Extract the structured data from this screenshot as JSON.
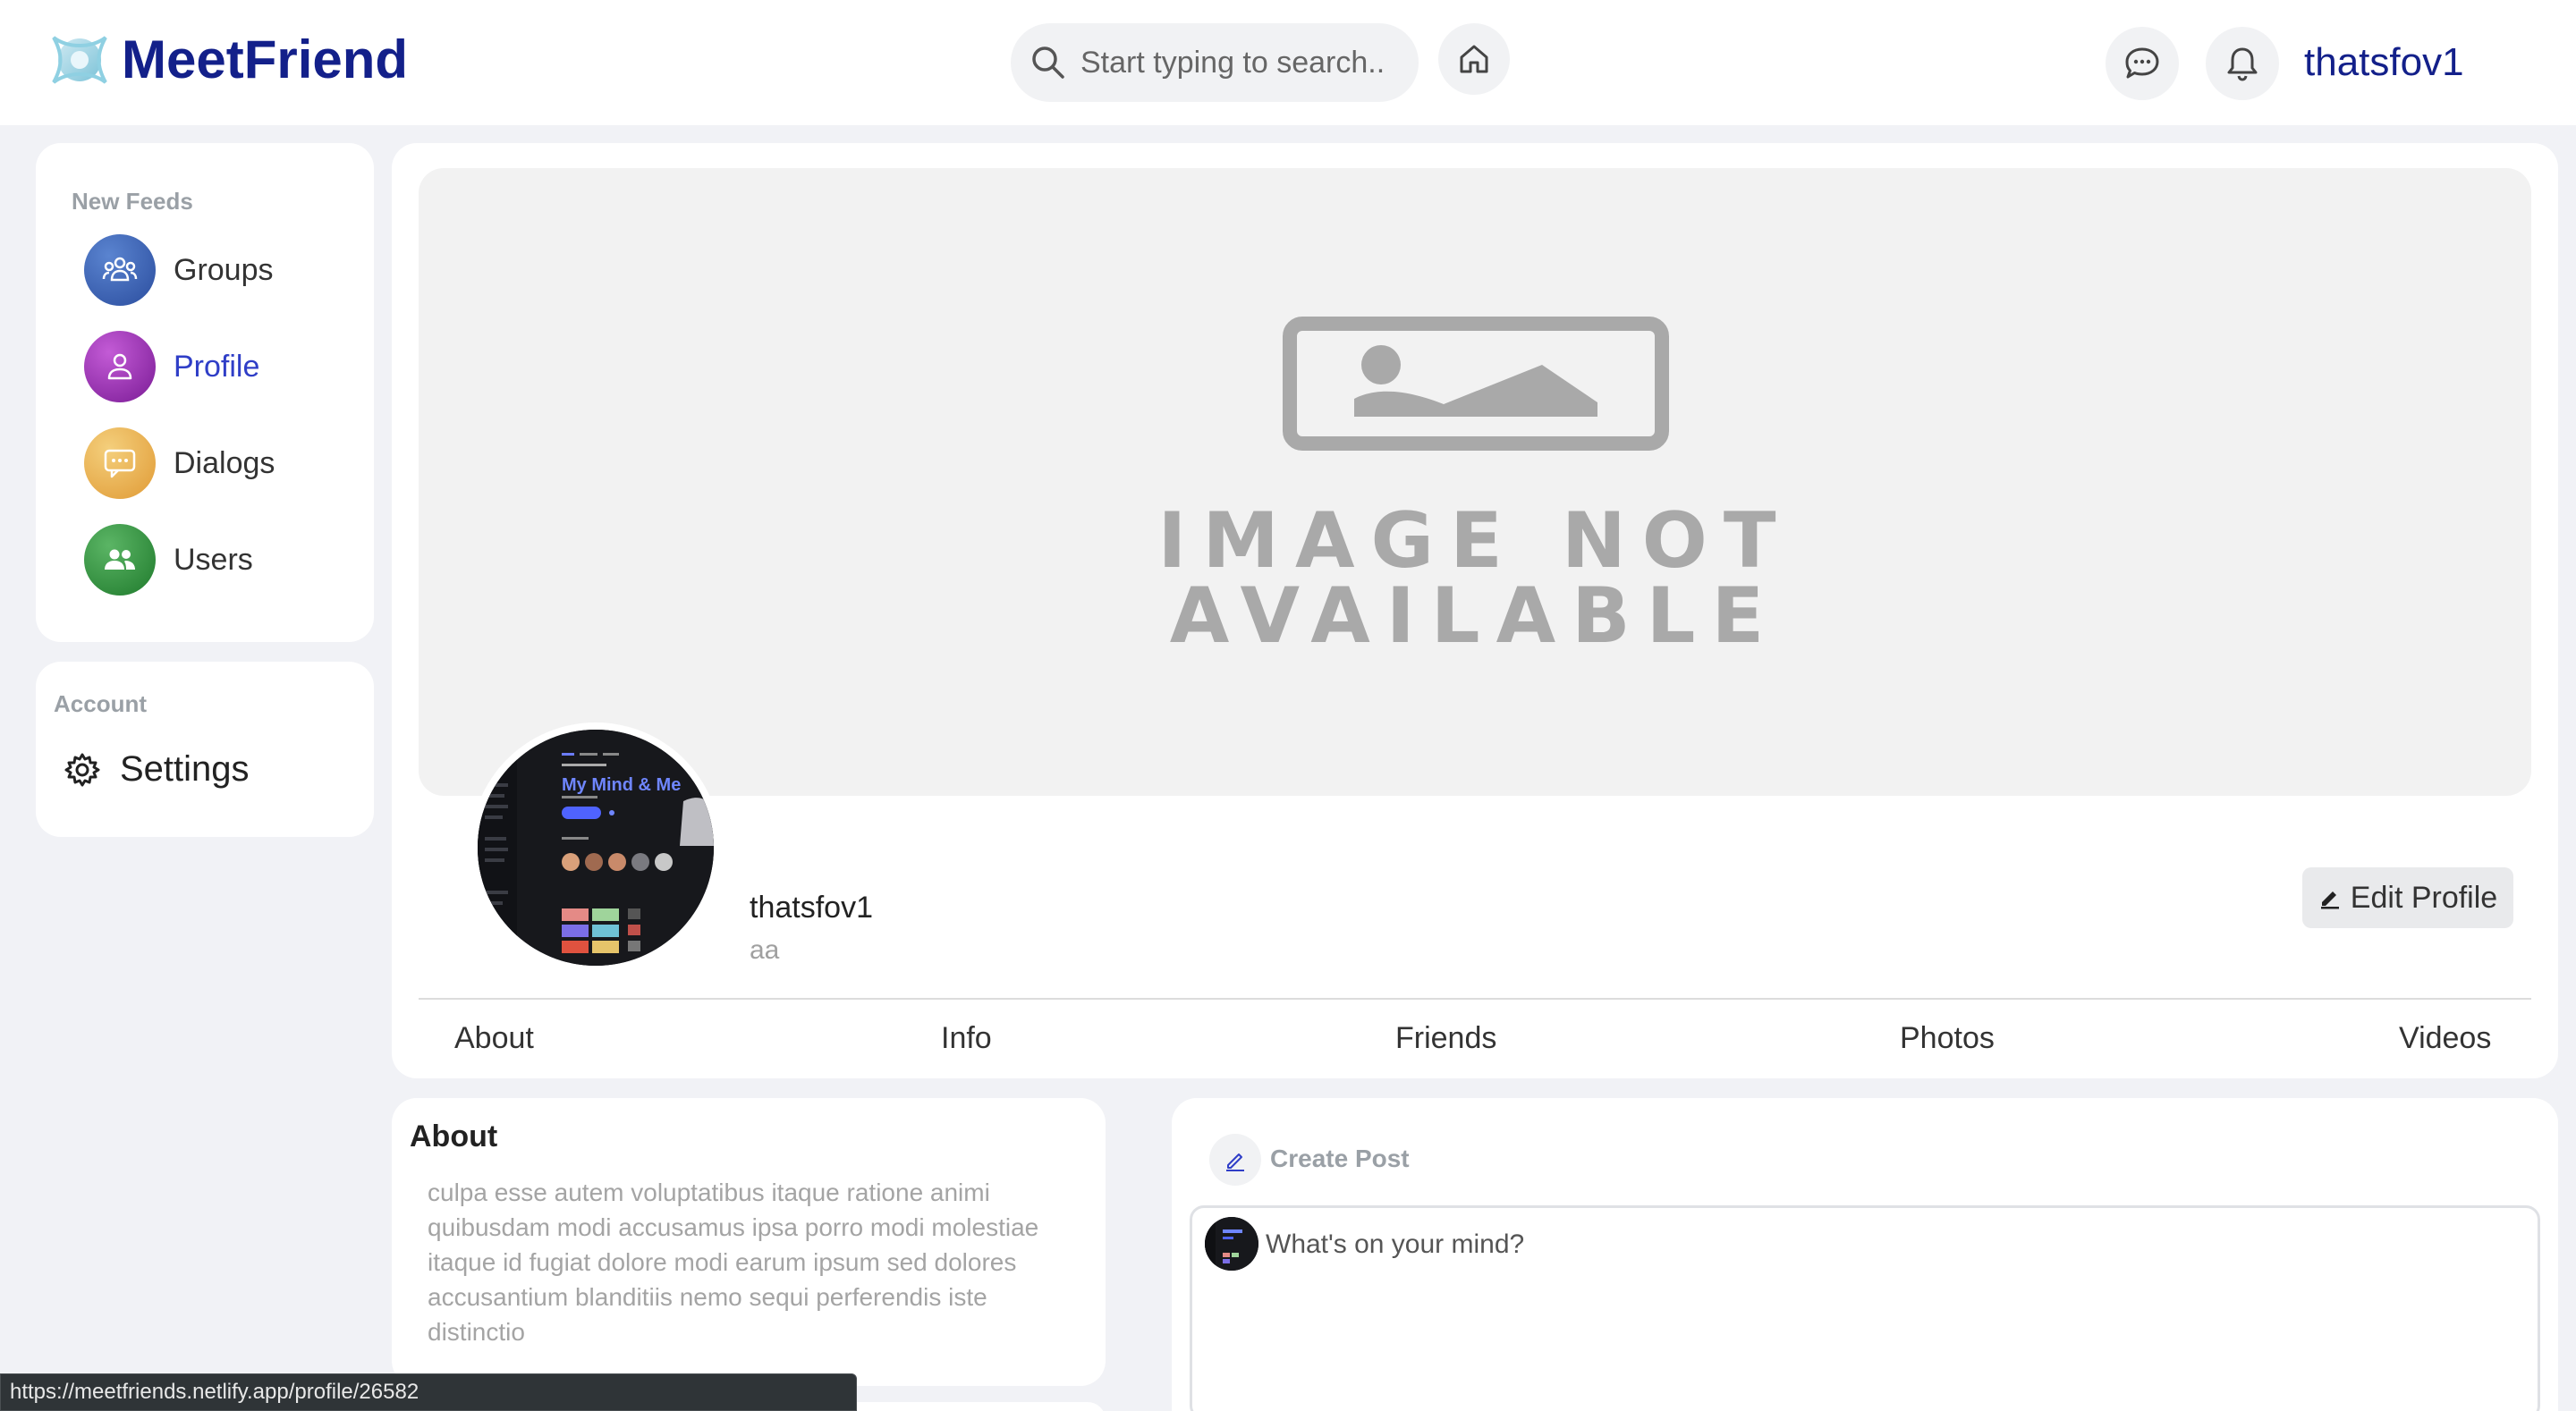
{
  "app": {
    "name": "MeetFriend",
    "brand_color": "#13208a",
    "accent_color": "#2f3ec7"
  },
  "header": {
    "search_placeholder": "Start typing to search..",
    "username": "thatsfov1",
    "icons": [
      "search-icon",
      "home-icon",
      "chat-bubble-icon",
      "bell-icon"
    ]
  },
  "sidebar": {
    "feeds_heading": "New Feeds",
    "items": [
      {
        "label": "Groups",
        "icon": "groups-icon",
        "color": "#3a5fb0",
        "active": false
      },
      {
        "label": "Profile",
        "icon": "user-icon",
        "color": "#8e2aa5",
        "active": true
      },
      {
        "label": "Dialogs",
        "icon": "message-icon",
        "color": "#e2a342",
        "active": false
      },
      {
        "label": "Users",
        "icon": "users-icon",
        "color": "#2e8a3a",
        "active": false
      }
    ],
    "account_heading": "Account",
    "settings_label": "Settings"
  },
  "profile": {
    "cover_text_line1": "IMAGE NOT",
    "cover_text_line2": "AVAILABLE",
    "name": "thatsfov1",
    "subtitle": "aa",
    "edit_label": "Edit Profile",
    "avatar_caption_title": "My Mind & Me",
    "tabs": [
      "About",
      "Info",
      "Friends",
      "Photos",
      "Videos"
    ]
  },
  "about": {
    "title": "About",
    "text": "culpa esse autem voluptatibus itaque ratione animi quibusdam modi accusamus ipsa porro modi molestiae itaque id fugiat dolore modi earum ipsum sed dolores accusantium blanditiis nemo sequi perferendis iste distinctio"
  },
  "create_post": {
    "label": "Create Post",
    "placeholder": "What's on your mind?"
  },
  "status_bar": {
    "url": "https://meetfriends.netlify.app/profile/26582"
  }
}
